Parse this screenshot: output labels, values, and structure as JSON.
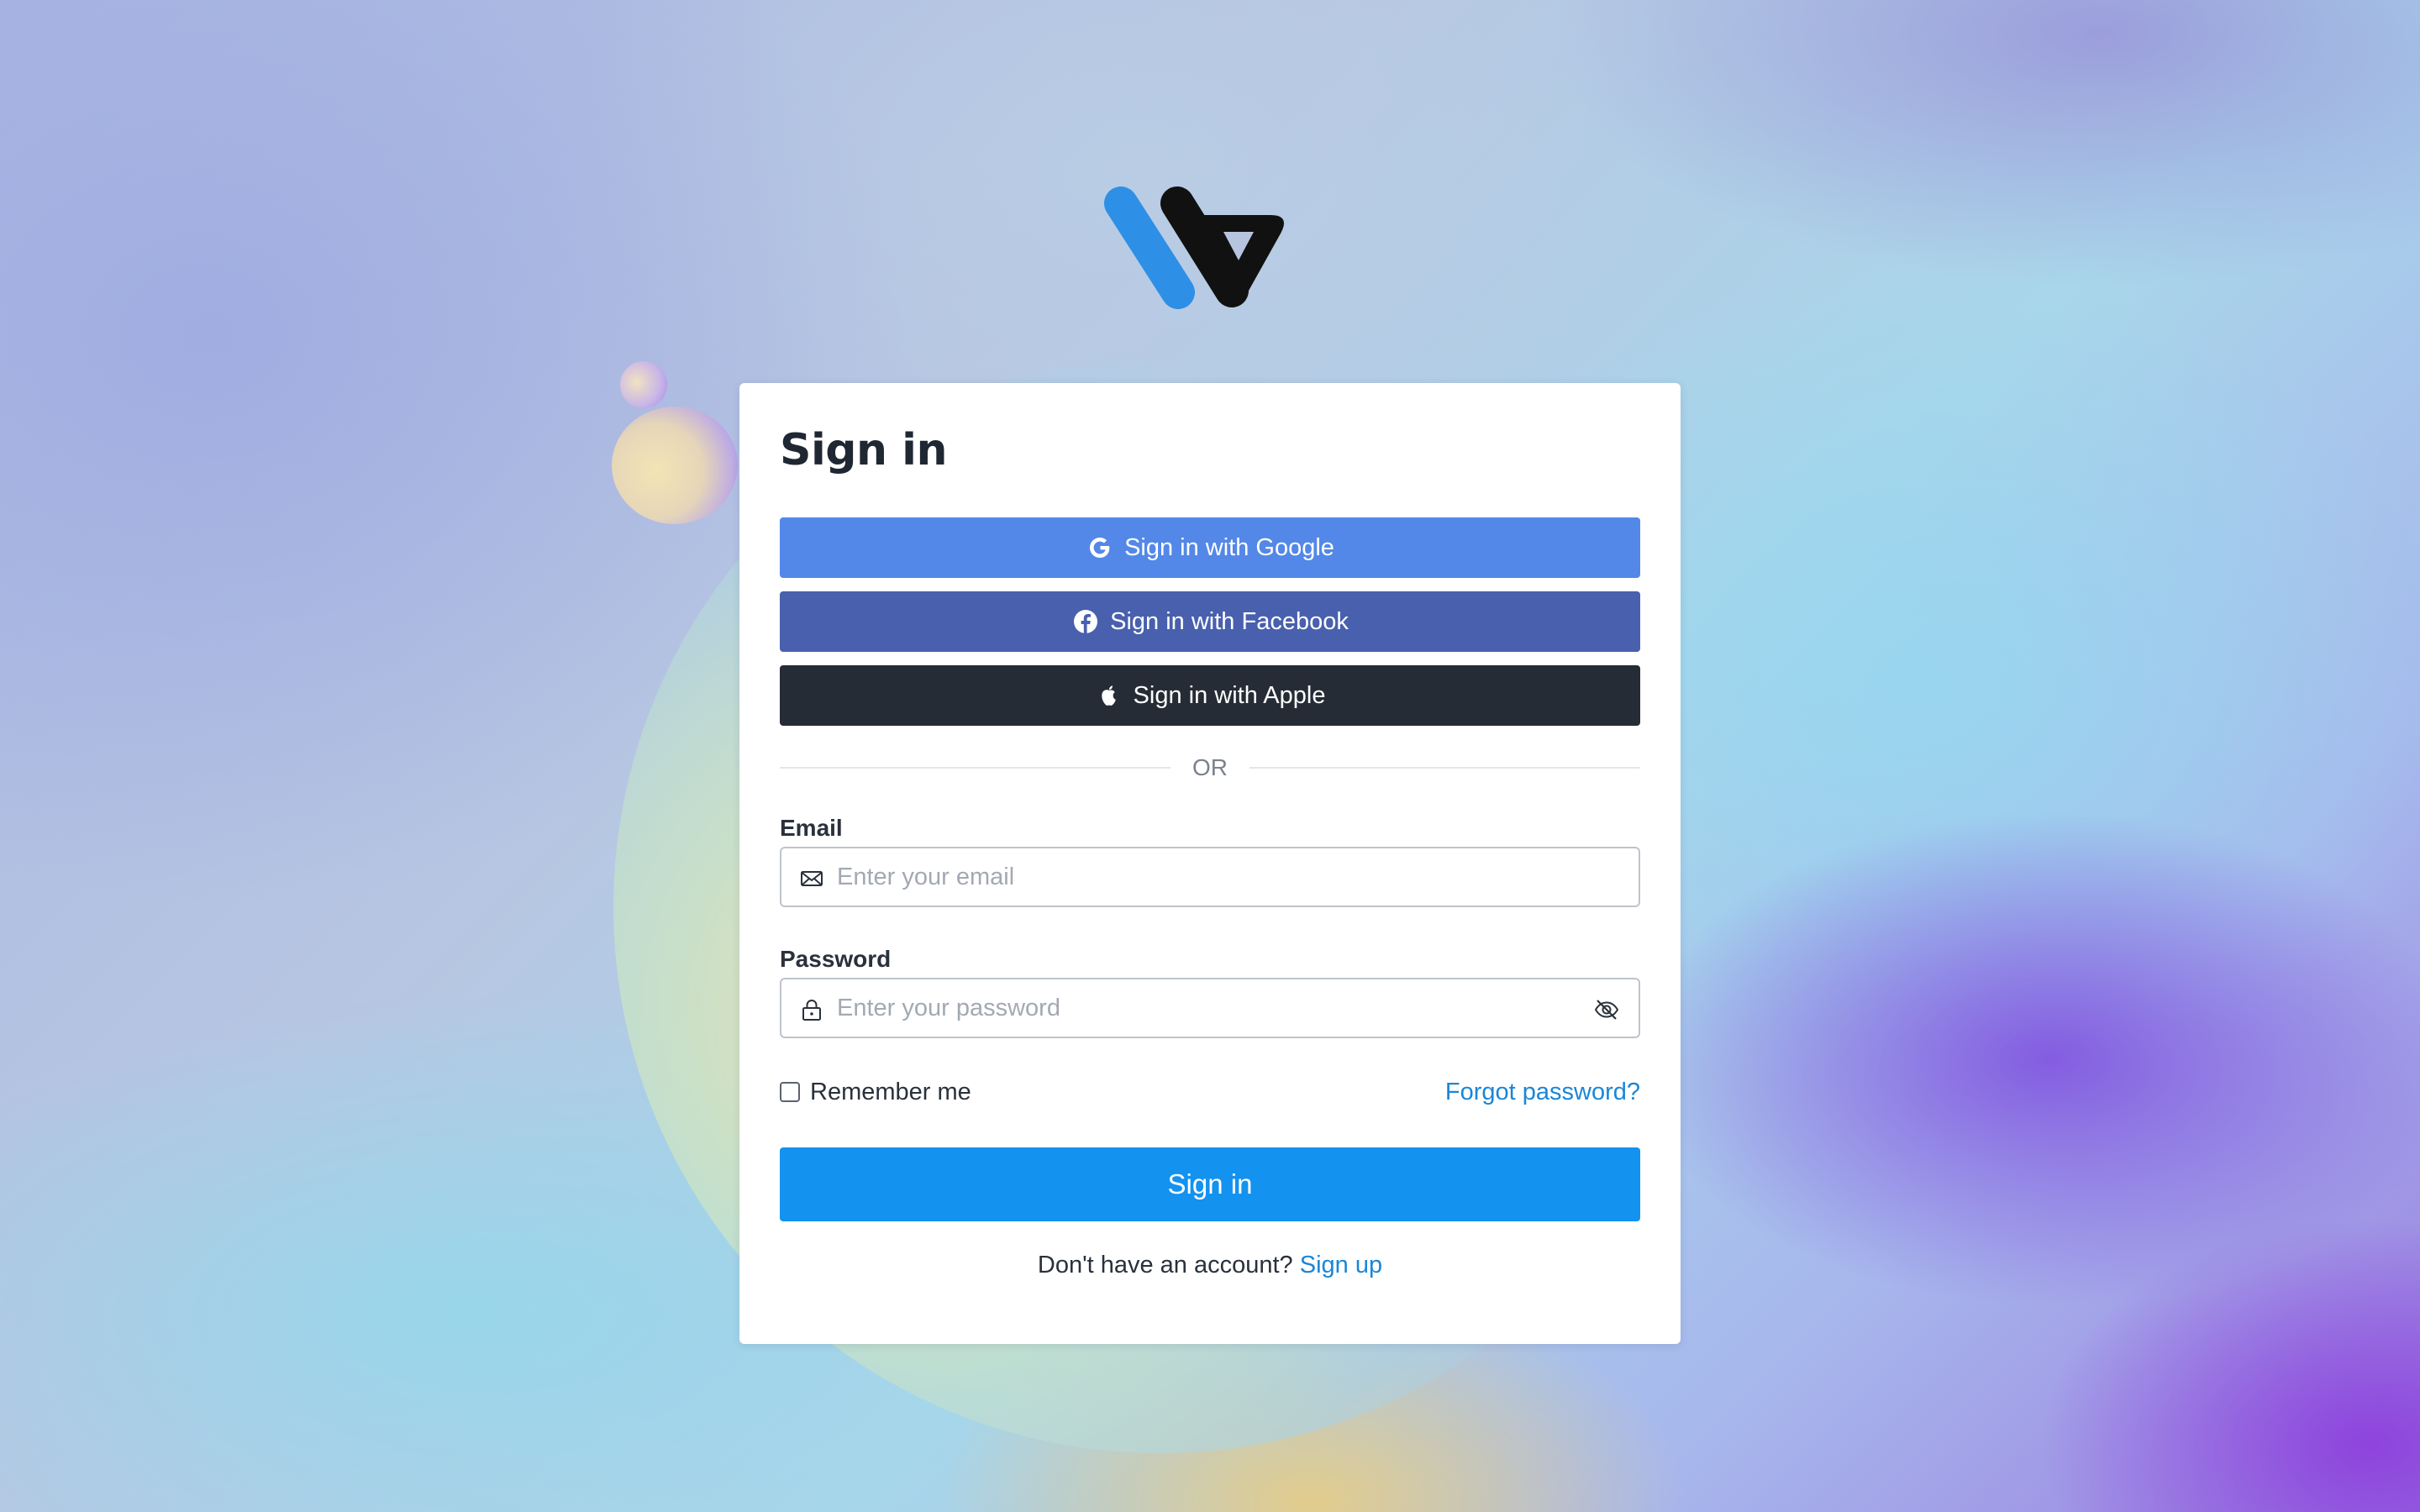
{
  "colors": {
    "google_button": "#5388e8",
    "facebook_button": "#4860ad",
    "apple_button": "#262c35",
    "primary_button": "#1392f0",
    "link": "#1a86d8",
    "logo_blue": "#2e8fe6",
    "logo_black": "#111111"
  },
  "brand": {
    "logo_icon": "w-logo-icon"
  },
  "signin": {
    "title": "Sign in",
    "social": {
      "google": {
        "label": "Sign in with Google",
        "icon": "google-icon"
      },
      "facebook": {
        "label": "Sign in with Facebook",
        "icon": "facebook-icon"
      },
      "apple": {
        "label": "Sign in with Apple",
        "icon": "apple-icon"
      }
    },
    "divider_text": "OR",
    "email": {
      "label": "Email",
      "placeholder": "Enter your email",
      "value": "",
      "icon": "envelope-icon"
    },
    "password": {
      "label": "Password",
      "placeholder": "Enter your password",
      "value": "",
      "icon": "lock-icon",
      "toggle_icon": "eye-off-icon"
    },
    "remember_label": "Remember me",
    "remember_checked": false,
    "forgot_label": "Forgot password?",
    "submit_label": "Sign in",
    "signup_prompt": "Don't have an account?",
    "signup_link": "Sign up"
  }
}
